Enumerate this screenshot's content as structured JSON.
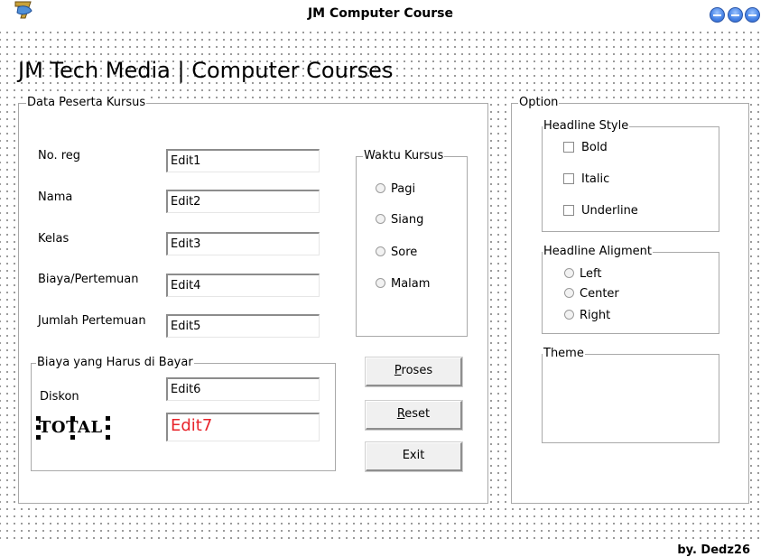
{
  "window": {
    "title": "JM Computer Course"
  },
  "headline": "JM Tech Media | Computer  Courses",
  "data_group": {
    "title": "Data Peserta Kursus",
    "fields": [
      {
        "label": "No. reg",
        "value": "Edit1"
      },
      {
        "label": "Nama",
        "value": "Edit2"
      },
      {
        "label": "Kelas",
        "value": "Edit3"
      },
      {
        "label": "Biaya/Pertemuan",
        "value": "Edit4"
      },
      {
        "label": "Jumlah Pertemuan",
        "value": "Edit5"
      }
    ]
  },
  "waktu_group": {
    "title": "Waktu Kursus",
    "options": [
      "Pagi",
      "Siang",
      "Sore",
      "Malam"
    ]
  },
  "biaya_group": {
    "title": "Biaya yang Harus di Bayar",
    "diskon_label": "Diskon",
    "diskon_value": "Edit6",
    "total_label": "TOTAL",
    "total_value": "Edit7"
  },
  "buttons": {
    "proses": {
      "mnemonic": "P",
      "rest": "roses"
    },
    "reset": {
      "mnemonic": "R",
      "rest": "eset"
    },
    "exit": "Exit"
  },
  "option_group": {
    "title": "Option",
    "headline_style": {
      "title": "Headline Style",
      "options": [
        "Bold",
        "Italic",
        "Underline"
      ]
    },
    "headline_alignment": {
      "title": "Headline Aligment",
      "options": [
        "Left",
        "Center",
        "Right"
      ]
    },
    "theme": {
      "title": "Theme"
    }
  },
  "credit": "by. Dedz26",
  "colors": {
    "total_value_text": "#e8232a",
    "window_button": "#4a86e8"
  },
  "icons": {
    "app": "delphi-helmet-icon",
    "window_buttons": [
      "minimize-button",
      "maximize-button",
      "close-button"
    ]
  }
}
